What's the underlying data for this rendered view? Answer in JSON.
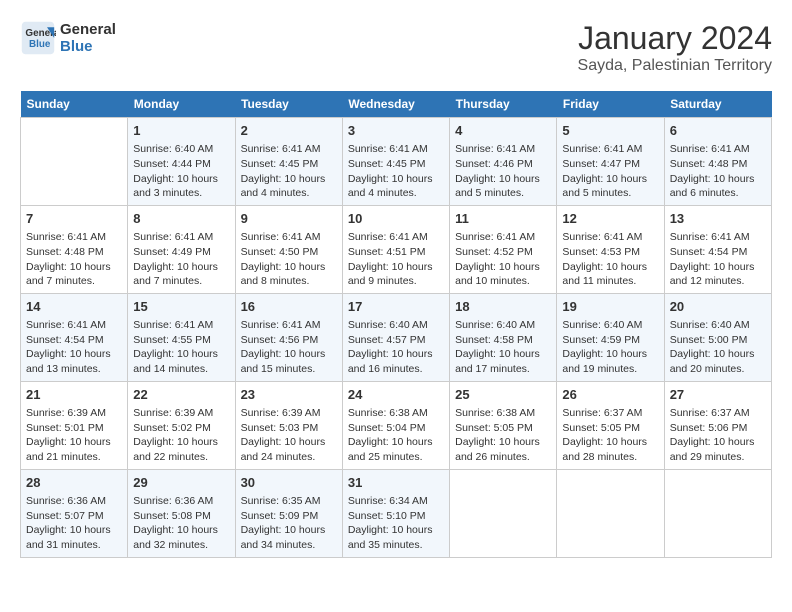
{
  "header": {
    "logo_line1": "General",
    "logo_line2": "Blue",
    "month": "January 2024",
    "location": "Sayda, Palestinian Territory"
  },
  "days_of_week": [
    "Sunday",
    "Monday",
    "Tuesday",
    "Wednesday",
    "Thursday",
    "Friday",
    "Saturday"
  ],
  "weeks": [
    [
      {
        "day": "",
        "info": ""
      },
      {
        "day": "1",
        "info": "Sunrise: 6:40 AM\nSunset: 4:44 PM\nDaylight: 10 hours\nand 3 minutes."
      },
      {
        "day": "2",
        "info": "Sunrise: 6:41 AM\nSunset: 4:45 PM\nDaylight: 10 hours\nand 4 minutes."
      },
      {
        "day": "3",
        "info": "Sunrise: 6:41 AM\nSunset: 4:45 PM\nDaylight: 10 hours\nand 4 minutes."
      },
      {
        "day": "4",
        "info": "Sunrise: 6:41 AM\nSunset: 4:46 PM\nDaylight: 10 hours\nand 5 minutes."
      },
      {
        "day": "5",
        "info": "Sunrise: 6:41 AM\nSunset: 4:47 PM\nDaylight: 10 hours\nand 5 minutes."
      },
      {
        "day": "6",
        "info": "Sunrise: 6:41 AM\nSunset: 4:48 PM\nDaylight: 10 hours\nand 6 minutes."
      }
    ],
    [
      {
        "day": "7",
        "info": "Sunrise: 6:41 AM\nSunset: 4:48 PM\nDaylight: 10 hours\nand 7 minutes."
      },
      {
        "day": "8",
        "info": "Sunrise: 6:41 AM\nSunset: 4:49 PM\nDaylight: 10 hours\nand 7 minutes."
      },
      {
        "day": "9",
        "info": "Sunrise: 6:41 AM\nSunset: 4:50 PM\nDaylight: 10 hours\nand 8 minutes."
      },
      {
        "day": "10",
        "info": "Sunrise: 6:41 AM\nSunset: 4:51 PM\nDaylight: 10 hours\nand 9 minutes."
      },
      {
        "day": "11",
        "info": "Sunrise: 6:41 AM\nSunset: 4:52 PM\nDaylight: 10 hours\nand 10 minutes."
      },
      {
        "day": "12",
        "info": "Sunrise: 6:41 AM\nSunset: 4:53 PM\nDaylight: 10 hours\nand 11 minutes."
      },
      {
        "day": "13",
        "info": "Sunrise: 6:41 AM\nSunset: 4:54 PM\nDaylight: 10 hours\nand 12 minutes."
      }
    ],
    [
      {
        "day": "14",
        "info": "Sunrise: 6:41 AM\nSunset: 4:54 PM\nDaylight: 10 hours\nand 13 minutes."
      },
      {
        "day": "15",
        "info": "Sunrise: 6:41 AM\nSunset: 4:55 PM\nDaylight: 10 hours\nand 14 minutes."
      },
      {
        "day": "16",
        "info": "Sunrise: 6:41 AM\nSunset: 4:56 PM\nDaylight: 10 hours\nand 15 minutes."
      },
      {
        "day": "17",
        "info": "Sunrise: 6:40 AM\nSunset: 4:57 PM\nDaylight: 10 hours\nand 16 minutes."
      },
      {
        "day": "18",
        "info": "Sunrise: 6:40 AM\nSunset: 4:58 PM\nDaylight: 10 hours\nand 17 minutes."
      },
      {
        "day": "19",
        "info": "Sunrise: 6:40 AM\nSunset: 4:59 PM\nDaylight: 10 hours\nand 19 minutes."
      },
      {
        "day": "20",
        "info": "Sunrise: 6:40 AM\nSunset: 5:00 PM\nDaylight: 10 hours\nand 20 minutes."
      }
    ],
    [
      {
        "day": "21",
        "info": "Sunrise: 6:39 AM\nSunset: 5:01 PM\nDaylight: 10 hours\nand 21 minutes."
      },
      {
        "day": "22",
        "info": "Sunrise: 6:39 AM\nSunset: 5:02 PM\nDaylight: 10 hours\nand 22 minutes."
      },
      {
        "day": "23",
        "info": "Sunrise: 6:39 AM\nSunset: 5:03 PM\nDaylight: 10 hours\nand 24 minutes."
      },
      {
        "day": "24",
        "info": "Sunrise: 6:38 AM\nSunset: 5:04 PM\nDaylight: 10 hours\nand 25 minutes."
      },
      {
        "day": "25",
        "info": "Sunrise: 6:38 AM\nSunset: 5:05 PM\nDaylight: 10 hours\nand 26 minutes."
      },
      {
        "day": "26",
        "info": "Sunrise: 6:37 AM\nSunset: 5:05 PM\nDaylight: 10 hours\nand 28 minutes."
      },
      {
        "day": "27",
        "info": "Sunrise: 6:37 AM\nSunset: 5:06 PM\nDaylight: 10 hours\nand 29 minutes."
      }
    ],
    [
      {
        "day": "28",
        "info": "Sunrise: 6:36 AM\nSunset: 5:07 PM\nDaylight: 10 hours\nand 31 minutes."
      },
      {
        "day": "29",
        "info": "Sunrise: 6:36 AM\nSunset: 5:08 PM\nDaylight: 10 hours\nand 32 minutes."
      },
      {
        "day": "30",
        "info": "Sunrise: 6:35 AM\nSunset: 5:09 PM\nDaylight: 10 hours\nand 34 minutes."
      },
      {
        "day": "31",
        "info": "Sunrise: 6:34 AM\nSunset: 5:10 PM\nDaylight: 10 hours\nand 35 minutes."
      },
      {
        "day": "",
        "info": ""
      },
      {
        "day": "",
        "info": ""
      },
      {
        "day": "",
        "info": ""
      }
    ]
  ]
}
